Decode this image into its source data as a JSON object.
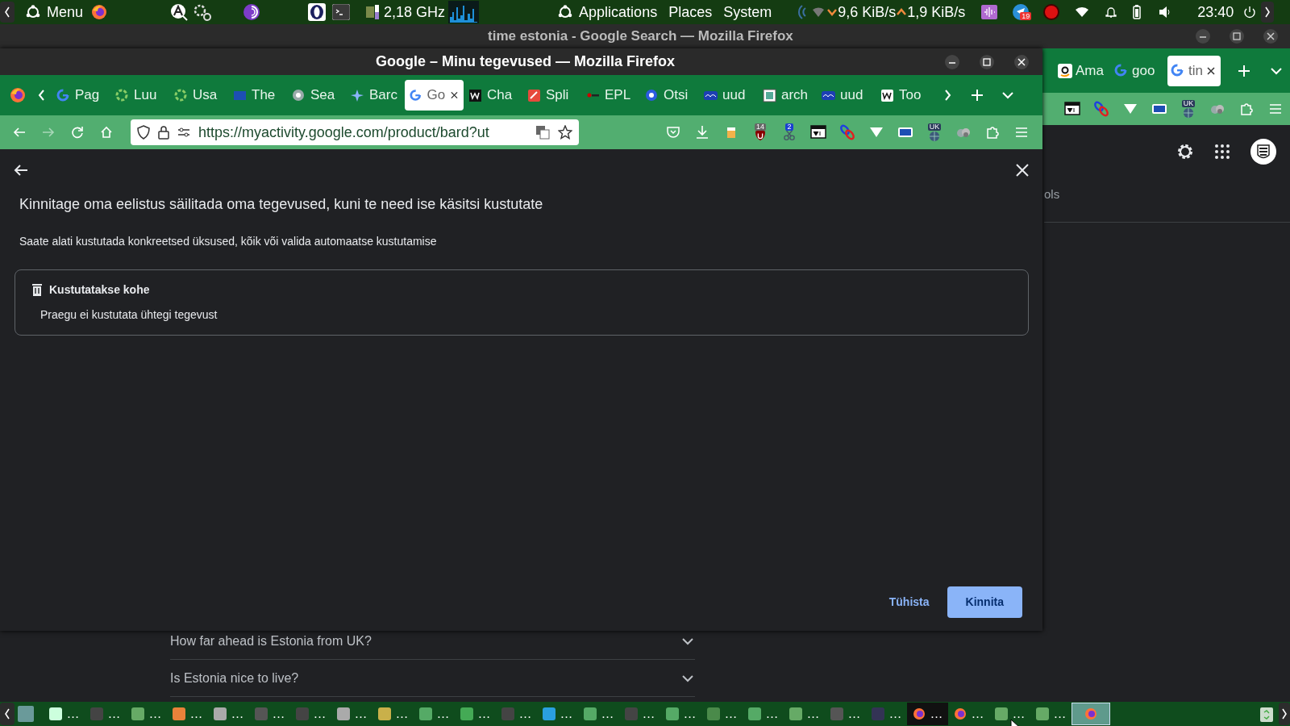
{
  "top_panel": {
    "menu_label": "Menu",
    "cpu_reading": "2,18 GHz",
    "menus": [
      "Applications",
      "Places",
      "System"
    ],
    "net_down": "9,6 KiB/s",
    "net_up": "1,9 KiB/s",
    "notification_badge": "19",
    "clock": "23:40"
  },
  "background_window": {
    "title": "time estonia - Google Search — Mozilla Firefox",
    "tabs": [
      {
        "label": "Ama",
        "selected": false
      },
      {
        "label": "goo",
        "selected": false
      },
      {
        "label": "tin",
        "selected": true
      }
    ],
    "toolbar_badge": "UK",
    "page": {
      "partial_text": "ols",
      "faq": [
        {
          "question": "How far ahead is Estonia from UK?",
          "expanded": false
        },
        {
          "question": "Is Estonia nice to live?",
          "expanded": false
        }
      ]
    }
  },
  "window": {
    "title": "Google – Minu tegevused — Mozilla Firefox",
    "tabs": [
      {
        "label": "Pag",
        "selected": false
      },
      {
        "label": "Luu",
        "selected": false
      },
      {
        "label": "Usa",
        "selected": false
      },
      {
        "label": "The",
        "selected": false
      },
      {
        "label": "Sea",
        "selected": false
      },
      {
        "label": "Barc",
        "selected": false
      },
      {
        "label": "Go",
        "selected": true
      },
      {
        "label": "Cha",
        "selected": false
      },
      {
        "label": "Spli",
        "selected": false
      },
      {
        "label": "EPL",
        "selected": false
      },
      {
        "label": "Otsi",
        "selected": false
      },
      {
        "label": "uud",
        "selected": false
      },
      {
        "label": "arch",
        "selected": false
      },
      {
        "label": "uud",
        "selected": false
      },
      {
        "label": "Too",
        "selected": false
      }
    ],
    "url": "https://myactivity.google.com/product/bard?ut",
    "extension_badges": [
      "14",
      "2",
      "UK"
    ],
    "dialog": {
      "heading": "Kinnitage oma eelistus säilitada oma tegevused, kuni te need ise käsitsi kustutate",
      "subtext": "Saate alati kustutada konkreetsed üksused, kõik või valida automaatse kustutamise",
      "card": {
        "title": "Kustutatakse kohe",
        "body": "Praegu ei kustutata ühtegi tegevust"
      },
      "cancel_button": "Tühista",
      "confirm_button": "Kinnita"
    }
  },
  "taskbar": {
    "items": [
      {
        "label": "…",
        "selected": false,
        "focused": false
      },
      {
        "label": "…",
        "selected": false,
        "focused": false
      },
      {
        "label": "…",
        "selected": false,
        "focused": false
      },
      {
        "label": "…",
        "selected": false,
        "focused": false
      },
      {
        "label": "…",
        "selected": false,
        "focused": false
      },
      {
        "label": "…",
        "selected": false,
        "focused": false
      },
      {
        "label": "…",
        "selected": false,
        "focused": false
      },
      {
        "label": "…",
        "selected": false,
        "focused": false
      },
      {
        "label": "…",
        "selected": false,
        "focused": false
      },
      {
        "label": "…",
        "selected": false,
        "focused": false
      },
      {
        "label": "…",
        "selected": false,
        "focused": false
      },
      {
        "label": "…",
        "selected": false,
        "focused": false
      },
      {
        "label": "…",
        "selected": false,
        "focused": false
      },
      {
        "label": "…",
        "selected": false,
        "focused": false
      },
      {
        "label": "…",
        "selected": false,
        "focused": false
      },
      {
        "label": "…",
        "selected": false,
        "focused": false
      },
      {
        "label": "…",
        "selected": false,
        "focused": false
      },
      {
        "label": "…",
        "selected": false,
        "focused": false
      },
      {
        "label": "…",
        "selected": false,
        "focused": false
      },
      {
        "label": "…",
        "selected": false,
        "focused": false
      },
      {
        "label": "…",
        "selected": false,
        "focused": false
      },
      {
        "label": "…",
        "selected": false,
        "focused": true
      },
      {
        "label": "…",
        "selected": false,
        "focused": false
      },
      {
        "label": "…",
        "selected": false,
        "focused": false
      },
      {
        "label": "…",
        "selected": false,
        "focused": false
      },
      {
        "selected": true,
        "focused": false
      }
    ]
  }
}
